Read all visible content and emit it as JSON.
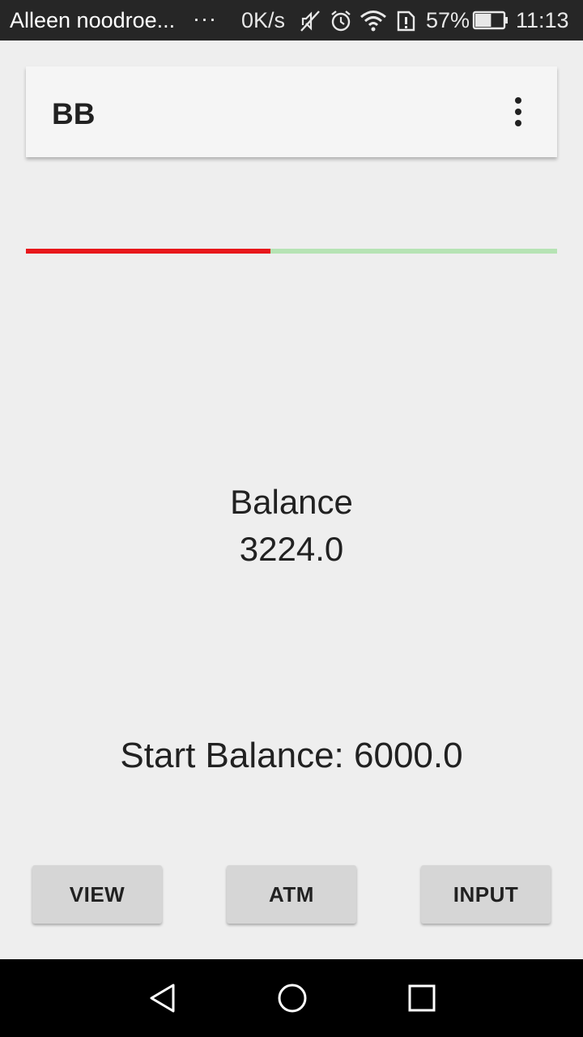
{
  "status_bar": {
    "notification_text": "Alleen noodroe...",
    "more_indicator": "···",
    "net_speed": "0K/s",
    "icons": [
      "mute-icon",
      "alarm-icon",
      "wifi-icon",
      "sim-alert-icon",
      "battery-icon"
    ],
    "battery_percent": "57%",
    "battery_level": 0.57,
    "time": "11:13"
  },
  "app_bar": {
    "title": "BB",
    "menu_icon": "more-vert-icon"
  },
  "progress": {
    "fraction": 0.46,
    "fill_color": "#e8171b",
    "track_color": "#b6e3b4"
  },
  "balance": {
    "label": "Balance",
    "value": "3224.0"
  },
  "start_balance": "Start Balance: 6000.0",
  "buttons": {
    "view": "VIEW",
    "atm": "ATM",
    "input": "INPUT"
  },
  "nav_bar": {
    "icons": [
      "back-icon",
      "home-icon",
      "recents-icon"
    ]
  }
}
